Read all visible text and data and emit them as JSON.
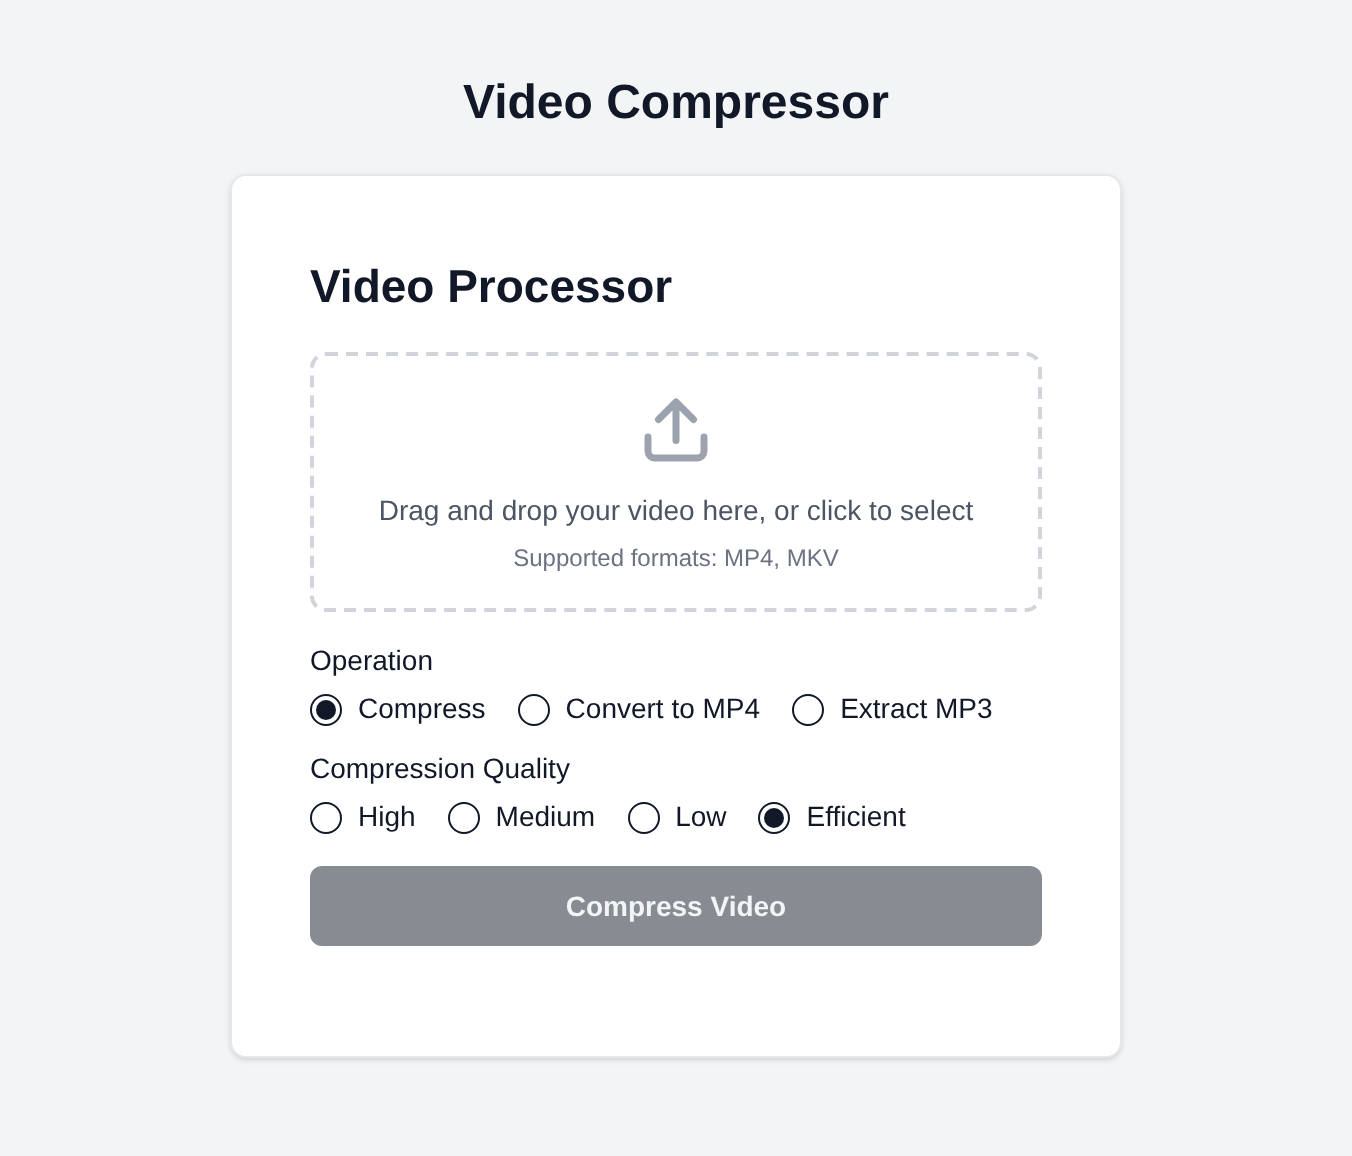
{
  "page_title": "Video Compressor",
  "card": {
    "heading": "Video Processor",
    "dropzone": {
      "text": "Drag and drop your video here, or click to select",
      "hint": "Supported formats: MP4, MKV"
    },
    "groups": [
      {
        "label": "Operation",
        "options": [
          {
            "label": "Compress",
            "selected": true
          },
          {
            "label": "Convert to MP4",
            "selected": false
          },
          {
            "label": "Extract MP3",
            "selected": false
          }
        ]
      },
      {
        "label": "Compression Quality",
        "options": [
          {
            "label": "High",
            "selected": false
          },
          {
            "label": "Medium",
            "selected": false
          },
          {
            "label": "Low",
            "selected": false
          },
          {
            "label": "Efficient",
            "selected": true
          }
        ]
      }
    ],
    "button": {
      "label": "Compress Video",
      "disabled": true
    }
  }
}
